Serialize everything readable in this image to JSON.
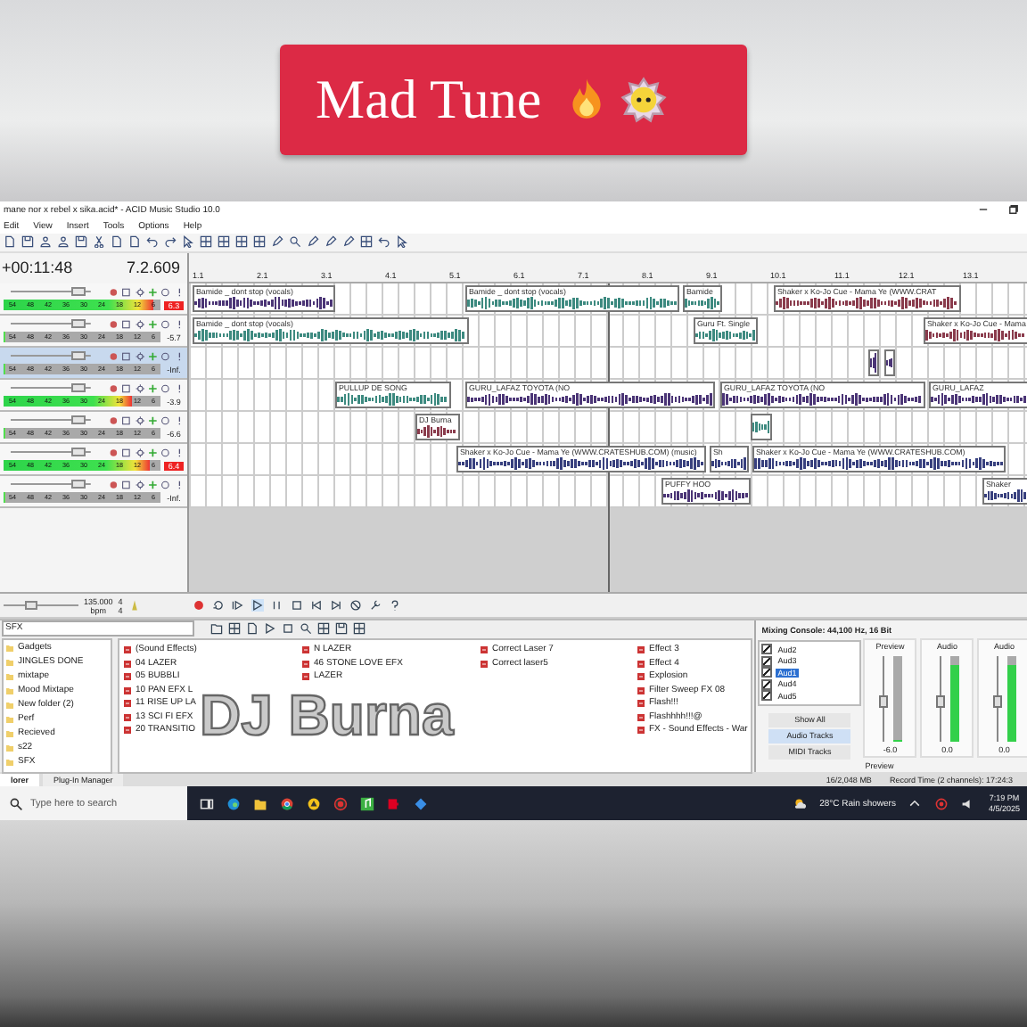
{
  "banner": {
    "title": "Mad Tune"
  },
  "window": {
    "title": "mane nor x rebel x sika.acid* - ACID Music Studio 10.0"
  },
  "menu": [
    "Edit",
    "View",
    "Insert",
    "Tools",
    "Options",
    "Help"
  ],
  "time": {
    "position": "+00:11:48",
    "measure": "7.2.609"
  },
  "ruler": [
    "1.1",
    "2.1",
    "3.1",
    "4.1",
    "5.1",
    "6.1",
    "7.1",
    "8.1",
    "9.1",
    "10.1",
    "11.1",
    "12.1",
    "13.1"
  ],
  "tracks": [
    {
      "selected": false,
      "level": 0.95,
      "clipped": true,
      "reading": "6.3",
      "scale": "54 48 42 36 30 24 18 12 6",
      "clips": [
        {
          "label": "Bamide _ dont stop (vocals)",
          "color": "#4b3576"
        },
        {
          "label": "Bamide _ dont stop (vocals)",
          "color": "#3d8a80"
        },
        {
          "label": "Bamide",
          "color": "#3d8a80"
        },
        {
          "label": "Shaker x Ko-Jo Cue - Mama Ye (WWW.CRAT",
          "color": "#8a3b4c"
        }
      ]
    },
    {
      "selected": false,
      "level": 0,
      "clipped": false,
      "reading": "-5.7",
      "scale": "54 48 42 36 30 24 18 12 6",
      "clips": [
        {
          "label": "Bamide _ dont stop (vocals)",
          "color": "#3d8a80"
        },
        {
          "label": "Guru Ft. Single",
          "color": "#3d8a80"
        },
        {
          "label": "Shaker x Ko-Jo Cue - Mama",
          "color": "#8a3b4c"
        }
      ]
    },
    {
      "selected": true,
      "level": 0,
      "clipped": false,
      "reading": "-Inf.",
      "scale": "54 48 42 36 30 24 18 12 6",
      "clips": [
        {
          "color": "#4b3576"
        },
        {
          "color": "#4b3576"
        }
      ]
    },
    {
      "selected": false,
      "level": 0.82,
      "clipped": false,
      "reading": "-3.9",
      "scale": "54 48 42 36 30 24 18 12 6",
      "clips": [
        {
          "label": "PULLUP DE SONG",
          "color": "#3d8a80"
        },
        {
          "label": "GURU_LAFAZ TOYOTA (NO",
          "color": "#4b3576"
        },
        {
          "label": "GURU_LAFAZ TOYOTA (NO",
          "color": "#4b3576"
        },
        {
          "label": "GURU_LAFAZ",
          "color": "#4b3576"
        }
      ]
    },
    {
      "selected": false,
      "level": 0,
      "clipped": false,
      "reading": "-6.6",
      "scale": "54 48 42 36 30 24 18 12 6",
      "clips": [
        {
          "label": "DJ Burna",
          "color": "#8a3b4c"
        },
        {
          "color": "#3d8a80"
        }
      ]
    },
    {
      "selected": false,
      "level": 0.93,
      "clipped": true,
      "reading": "6.4",
      "scale": "54 48 42 36 30 24 18 12 6",
      "clips": [
        {
          "label": "Shaker x Ko-Jo Cue - Mama Ye (WWW.CRATESHUB.COM) (music)",
          "color": "#38407e"
        },
        {
          "label": "Sh",
          "color": "#38407e"
        },
        {
          "label": "Shaker x Ko-Jo Cue - Mama Ye (WWW.CRATESHUB.COM)",
          "color": "#38407e"
        }
      ]
    },
    {
      "selected": false,
      "level": 0,
      "clipped": false,
      "reading": "-Inf.",
      "scale": "54 48 42 36 30 24 18 12 6",
      "clips": [
        {
          "label": "PUFFY HOO",
          "color": "#4b3576"
        },
        {
          "label": "Shaker",
          "color": "#38407e"
        }
      ]
    }
  ],
  "transport": {
    "level": 0.35,
    "tempo": "135.000",
    "tempo_unit": "bpm",
    "beats": "4",
    "beat_unit": "4"
  },
  "explorer": {
    "path": "SFX",
    "folders": [
      "Gadgets",
      "JINGLES DONE",
      "mixtape",
      "Mood Mixtape",
      "New folder (2)",
      "Perf",
      "Recieved",
      "s22",
      "SFX"
    ],
    "file_columns": [
      {
        "files": [
          "(Sound Effects)",
          "04 LAZER",
          "05 BUBBLI",
          "10 PAN EFX L",
          "11 RISE UP LA",
          "13 SCI FI EFX",
          "20 TRANSITIO"
        ]
      },
      {
        "files": [
          "N LAZER",
          "46 STONE LOVE EFX",
          "LAZER"
        ]
      },
      {
        "files": [
          "Correct Laser 7",
          "Correct laser5"
        ]
      },
      {
        "files": [
          "Effect 3",
          "Effect 4",
          "Explosion",
          "Filter Sweep FX 08",
          "Flash!!!",
          "Flashhhh!!!@",
          "FX - Sound Effects - War"
        ]
      }
    ]
  },
  "tabs": [
    {
      "label": "lorer",
      "selected": true
    },
    {
      "label": "Plug-In Manager",
      "selected": false
    }
  ],
  "mixer": {
    "title": "Mixing Console: 44,100 Hz, 16 Bit",
    "tracks": [
      {
        "label": "Aud2",
        "checked": true,
        "selected": false
      },
      {
        "label": "Aud3",
        "checked": true,
        "selected": false
      },
      {
        "label": "Aud1",
        "checked": true,
        "selected": true
      },
      {
        "label": "Aud4",
        "checked": true,
        "selected": false
      },
      {
        "label": "Aud5",
        "checked": true,
        "selected": false
      }
    ],
    "buttons": [
      {
        "label": "Show All",
        "selected": false
      },
      {
        "label": "Audio Tracks",
        "selected": true
      },
      {
        "label": "MIDI Tracks",
        "selected": false
      }
    ],
    "strips": [
      {
        "label": "Preview",
        "reading": "-6.0",
        "level": 0
      },
      {
        "label": "Audio",
        "reading": "0.0",
        "level": 0.9
      },
      {
        "label": "Audio",
        "reading": "0.0",
        "level": 0.9
      }
    ],
    "footer": "Preview"
  },
  "status": {
    "memory": "16/2,048 MB",
    "record_time": "Record Time (2 channels): 17:24:3"
  },
  "taskbar": {
    "search_placeholder": "Type here to search",
    "weather": "28°C  Rain showers",
    "time": "7:19 PM",
    "date": "4/5/2025"
  },
  "overlay": {
    "text": "DJ Burna"
  }
}
